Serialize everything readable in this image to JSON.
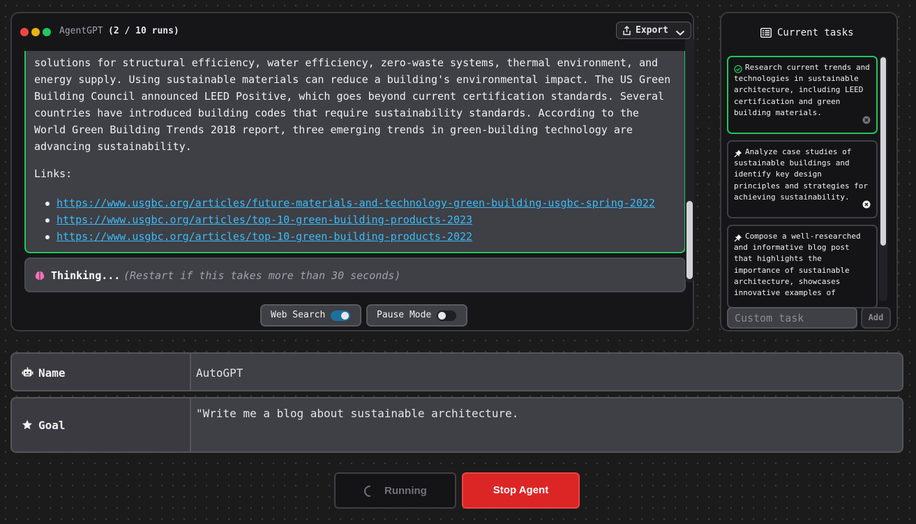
{
  "app": {
    "title": "AgentGPT",
    "run_count": "(2 / 10 runs)",
    "export_label": "Export"
  },
  "output": {
    "paragraph": "solutions for structural efficiency, water efficiency, zero-waste systems, thermal environment, and energy supply. Using sustainable materials can reduce a building's environmental impact. The US Green Building Council announced LEED Positive, which goes beyond current certification standards. Several countries have introduced building codes that require sustainability standards. According to the World Green Building Trends 2018 report, three emerging trends in green-building technology are advancing sustainability.",
    "links_label": "Links:",
    "links": [
      "https://www.usgbc.org/articles/future-materials-and-technology-green-building-usgbc-spring-2022",
      "https://www.usgbc.org/articles/top-10-green-building-products-2023",
      "https://www.usgbc.org/articles/top-10-green-building-products-2022"
    ]
  },
  "thinking": {
    "label": "Thinking...",
    "hint": "(Restart if this takes more than 30 seconds)"
  },
  "toggles": {
    "web_search": {
      "label": "Web Search",
      "on": true
    },
    "pause_mode": {
      "label": "Pause Mode",
      "on": false
    }
  },
  "tasks": {
    "title": "Current tasks",
    "items": [
      {
        "text": "Research current trends and technologies in sustainable architecture, including LEED certification and green building materials.",
        "status": "completed"
      },
      {
        "text": "Analyze case studies of sustainable buildings and identify key design principles and strategies for achieving sustainability.",
        "status": "pending"
      },
      {
        "text": "Compose a well-researched and informative blog post that highlights the importance of sustainable architecture, showcases innovative examples of",
        "status": "pending"
      }
    ],
    "custom_placeholder": "Custom task",
    "add_label": "Add"
  },
  "form": {
    "name_label": "Name",
    "name_value": "AutoGPT",
    "goal_label": "Goal",
    "goal_value": "\"Write me a blog about sustainable architecture."
  },
  "actions": {
    "running_label": "Running",
    "stop_label": "Stop Agent"
  },
  "colors": {
    "accent_green": "#22c55e",
    "link_blue": "#38bdf8",
    "stop_red": "#dc2626",
    "toggle_on": "#1e6f9e"
  },
  "icons": [
    "export-icon",
    "chevron-down-icon",
    "brain-icon",
    "task-list-icon",
    "check-circle-icon",
    "pin-icon",
    "close-circle-icon",
    "robot-icon",
    "star-icon",
    "spinner-icon"
  ]
}
